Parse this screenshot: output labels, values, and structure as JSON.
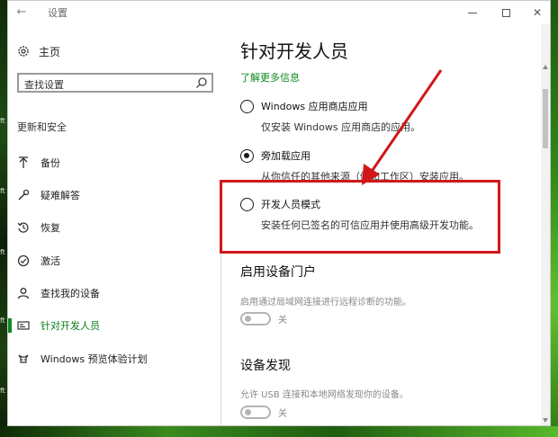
{
  "window": {
    "title": "设置",
    "minimize_icon": "minimize-icon",
    "maximize_icon": "maximize-icon",
    "close_icon": "close-icon"
  },
  "sidebar": {
    "home_label": "主页",
    "search_placeholder": "查找设置",
    "section_title": "更新和安全",
    "items": [
      {
        "label": "备份",
        "icon": "backup-arrow-icon"
      },
      {
        "label": "疑难解答",
        "icon": "wrench-icon"
      },
      {
        "label": "恢复",
        "icon": "history-icon"
      },
      {
        "label": "激活",
        "icon": "check-circle-icon"
      },
      {
        "label": "查找我的设备",
        "icon": "person-icon"
      },
      {
        "label": "针对开发人员",
        "icon": "developer-icon",
        "active": true
      },
      {
        "label": "Windows 预览体验计划",
        "icon": "insider-cat-icon"
      }
    ]
  },
  "main": {
    "title": "针对开发人员",
    "learn_more": "了解更多信息",
    "options": [
      {
        "label": "Windows 应用商店应用",
        "desc": "仅安装 Windows 应用商店的应用。",
        "checked": false
      },
      {
        "label": "旁加载应用",
        "desc": "从你信任的其他来源（例如工作区）安装应用。",
        "checked": true
      },
      {
        "label": "开发人员模式",
        "desc": "安装任何已签名的可信应用并使用高级开发功能。",
        "checked": false
      }
    ],
    "device_portal": {
      "title": "启用设备门户",
      "desc": "启用通过局域网连接进行远程诊断的功能。",
      "toggle_state": "关"
    },
    "device_discovery": {
      "title": "设备发现",
      "desc": "允许 USB 连接和本地网络发现你的设备。",
      "toggle_state": "关"
    }
  },
  "desktop_fragments": [
    "ft",
    "ft",
    "ft",
    "ft",
    "ft"
  ],
  "colors": {
    "accent": "#0e8a1e",
    "annotation": "#d01818"
  }
}
